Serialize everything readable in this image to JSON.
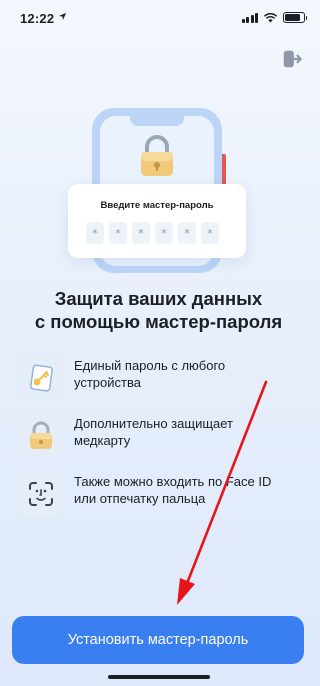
{
  "status_bar": {
    "time": "12:22",
    "location_icon": "location-arrow-icon",
    "signal_icon": "cellular-signal-icon",
    "wifi_icon": "wifi-icon",
    "battery_icon": "battery-icon",
    "battery_level": 0.85
  },
  "header": {
    "logout_icon": "logout-icon"
  },
  "illustration": {
    "card_title": "Введите мастер-пароль",
    "pin_placeholder": [
      "*",
      "*",
      "*",
      "*",
      "*",
      "*"
    ]
  },
  "headline": {
    "line1": "Защита ваших данных",
    "line2": "с помощью мастер-пароля"
  },
  "features": [
    {
      "icon": "key-card-icon",
      "line1": "Единый пароль с любого",
      "line2": "устройства"
    },
    {
      "icon": "lock-icon",
      "line1": "Дополнительно защищает",
      "line2": "медкарту"
    },
    {
      "icon": "face-id-icon",
      "line1": "Также можно входить по Face ID",
      "line2": "или отпечатку пальца"
    }
  ],
  "actions": {
    "primary_label": "Установить мастер-пароль"
  },
  "colors": {
    "accent": "#3a7ff0",
    "annotation_arrow": "#e8141b",
    "background_top": "#f3f7fd",
    "background_bottom": "#dde8fa"
  }
}
